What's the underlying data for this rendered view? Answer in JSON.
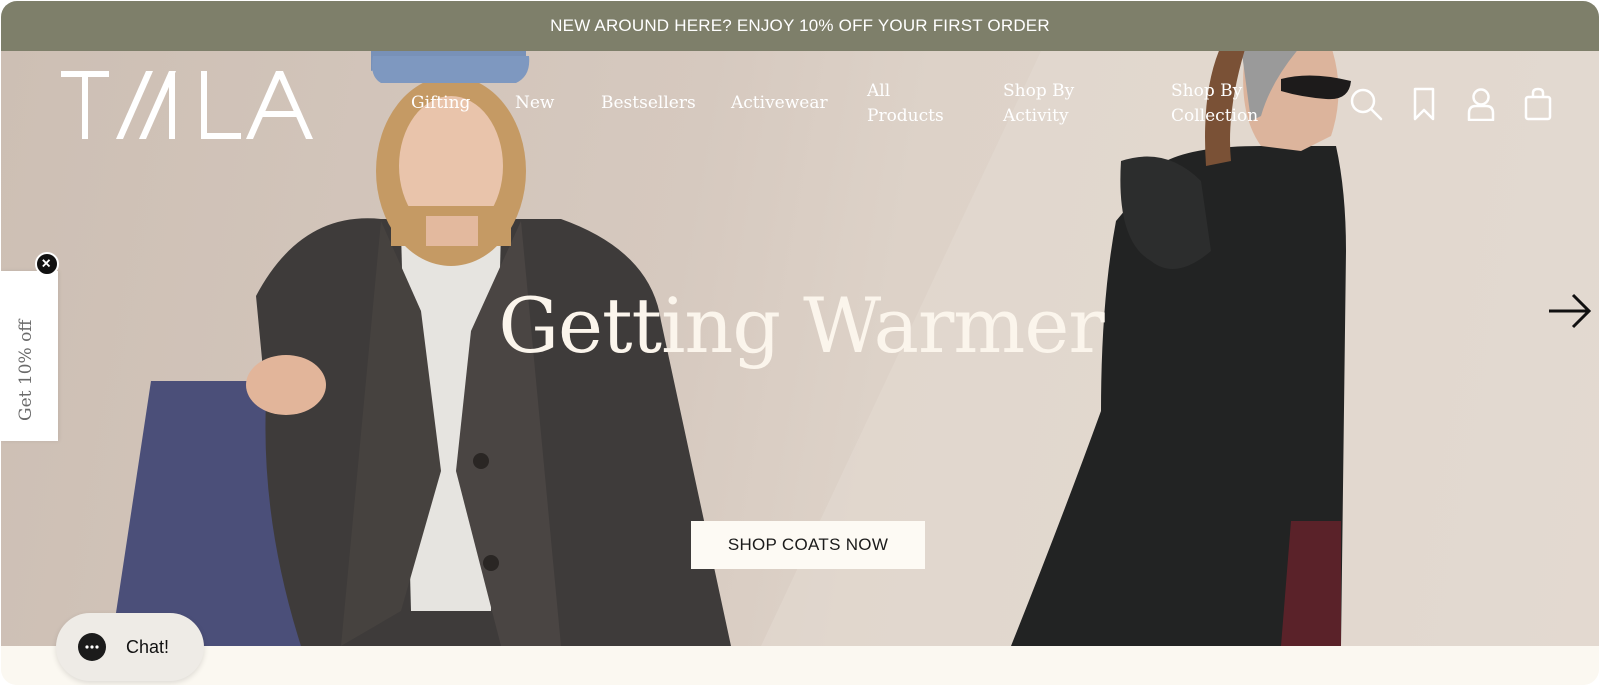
{
  "announcement": {
    "text": "NEW AROUND HERE? ENJOY 10% OFF YOUR FIRST ORDER"
  },
  "brand": {
    "logo_text": "TALA"
  },
  "nav": {
    "items": [
      {
        "label": "Gifting"
      },
      {
        "label": "New"
      },
      {
        "label": "Bestsellers"
      },
      {
        "label": "Activewear"
      },
      {
        "label": "All Products"
      },
      {
        "label": "Shop By Activity"
      },
      {
        "label": "Shop By Collection"
      }
    ]
  },
  "header_icons": [
    "search-icon",
    "bookmark-icon",
    "account-icon",
    "bag-icon"
  ],
  "hero": {
    "headline": "Getting Warmer",
    "cta_label": "SHOP COATS NOW",
    "next_icon": "arrow-right-icon"
  },
  "promo_tab": {
    "label": "Get 10% off",
    "close_icon": "close-icon"
  },
  "chat": {
    "label": "Chat!",
    "icon": "chat-icon"
  },
  "colors": {
    "announcement_bg": "#7e7f6a",
    "hero_bg": "#d6c9bf",
    "cta_bg": "#fdfaf4",
    "page_bg": "#fbf8f1"
  }
}
